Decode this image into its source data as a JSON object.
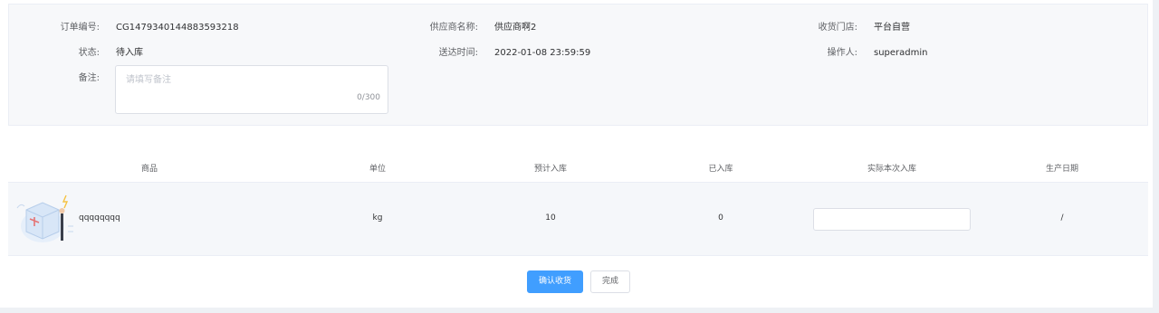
{
  "order": {
    "order_no_label": "订单编号:",
    "order_no": "CG1479340144883593218",
    "supplier_label": "供应商名称:",
    "supplier": "供应商啊2",
    "store_label": "收货门店:",
    "store": "平台自营",
    "status_label": "状态:",
    "status": "待入库",
    "delivery_label": "送达时间:",
    "delivery_time": "2022-01-08 23:59:59",
    "operator_label": "操作人:",
    "operator": "superadmin",
    "remark_label": "备注:",
    "remark_placeholder": "请填写备注",
    "remark_count": "0/300"
  },
  "table": {
    "headers": [
      "商品",
      "单位",
      "预计入库",
      "已入库",
      "实际本次入库",
      "生产日期"
    ],
    "rows": [
      {
        "product": "qqqqqqqq",
        "unit": "kg",
        "expected": "10",
        "received": "0",
        "actual": "",
        "production_date": "/"
      }
    ]
  },
  "actions": {
    "confirm_label": "确认收货",
    "done_label": "完成"
  },
  "colors": {
    "primary": "#409eff",
    "panel_bg": "#f7f8fa",
    "row_bg": "#f5f7fa"
  }
}
